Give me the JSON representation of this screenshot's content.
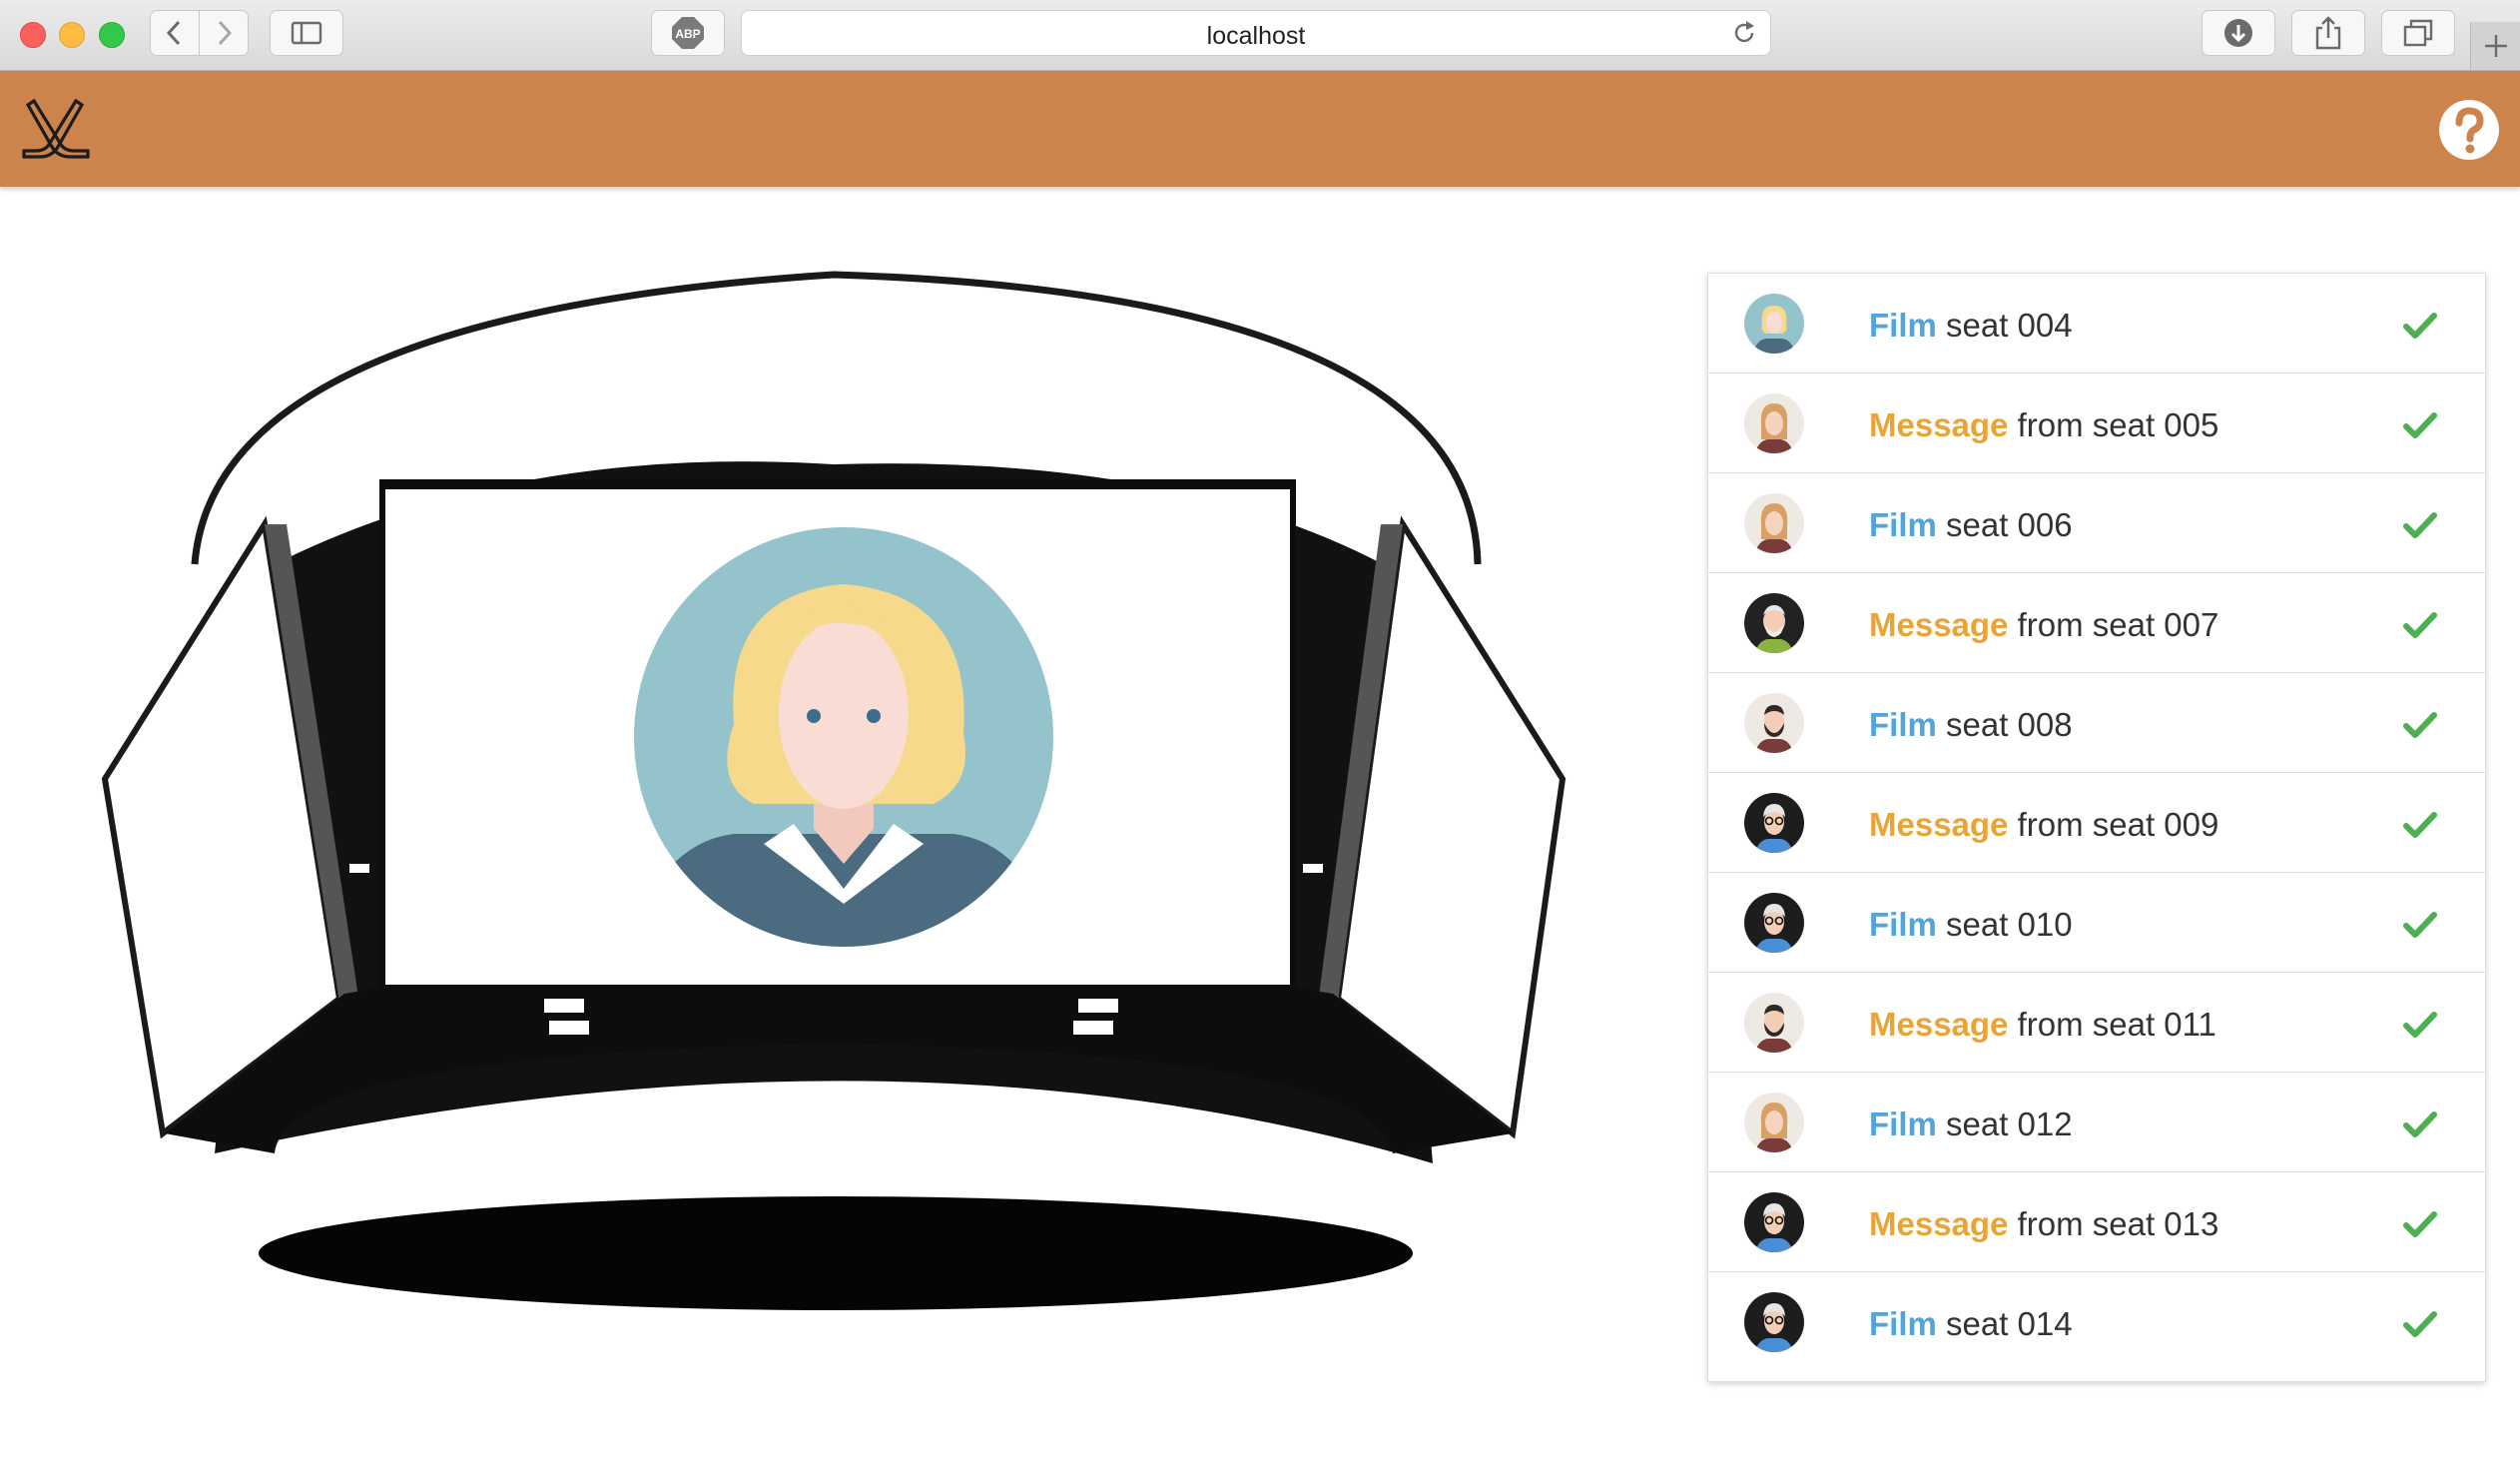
{
  "browser": {
    "url": "localhost",
    "abp_label": "ABP"
  },
  "colors": {
    "header": "#cd834c",
    "film": "#52a5d8",
    "message": "#e9a437",
    "check": "#4caf50"
  },
  "header": {
    "logo_icon": "crossed-hockey-sticks-icon",
    "help_icon": "question-circle-icon"
  },
  "list": {
    "items": [
      {
        "kind": "Film",
        "text": "seat 004",
        "avatar": "blonde-woman-avatar",
        "status": "check-icon"
      },
      {
        "kind": "Message",
        "text": "from seat 005",
        "avatar": "ginger-woman-avatar",
        "status": "check-icon"
      },
      {
        "kind": "Film",
        "text": "seat 006",
        "avatar": "ginger-woman-avatar",
        "status": "check-icon"
      },
      {
        "kind": "Message",
        "text": "from seat 007",
        "avatar": "old-man-avatar",
        "status": "check-icon"
      },
      {
        "kind": "Film",
        "text": "seat 008",
        "avatar": "bearded-man-avatar",
        "status": "check-icon"
      },
      {
        "kind": "Message",
        "text": "from seat 009",
        "avatar": "glasses-woman-avatar",
        "status": "check-icon"
      },
      {
        "kind": "Film",
        "text": "seat 010",
        "avatar": "glasses-woman-avatar",
        "status": "check-icon"
      },
      {
        "kind": "Message",
        "text": "from seat 011",
        "avatar": "bearded-man-avatar",
        "status": "check-icon"
      },
      {
        "kind": "Film",
        "text": "seat 012",
        "avatar": "ginger-woman-avatar",
        "status": "check-icon"
      },
      {
        "kind": "Message",
        "text": "from seat 013",
        "avatar": "glasses-woman-avatar",
        "status": "check-icon"
      },
      {
        "kind": "Film",
        "text": "seat 014",
        "avatar": "glasses-woman-avatar",
        "status": "check-icon"
      }
    ]
  }
}
